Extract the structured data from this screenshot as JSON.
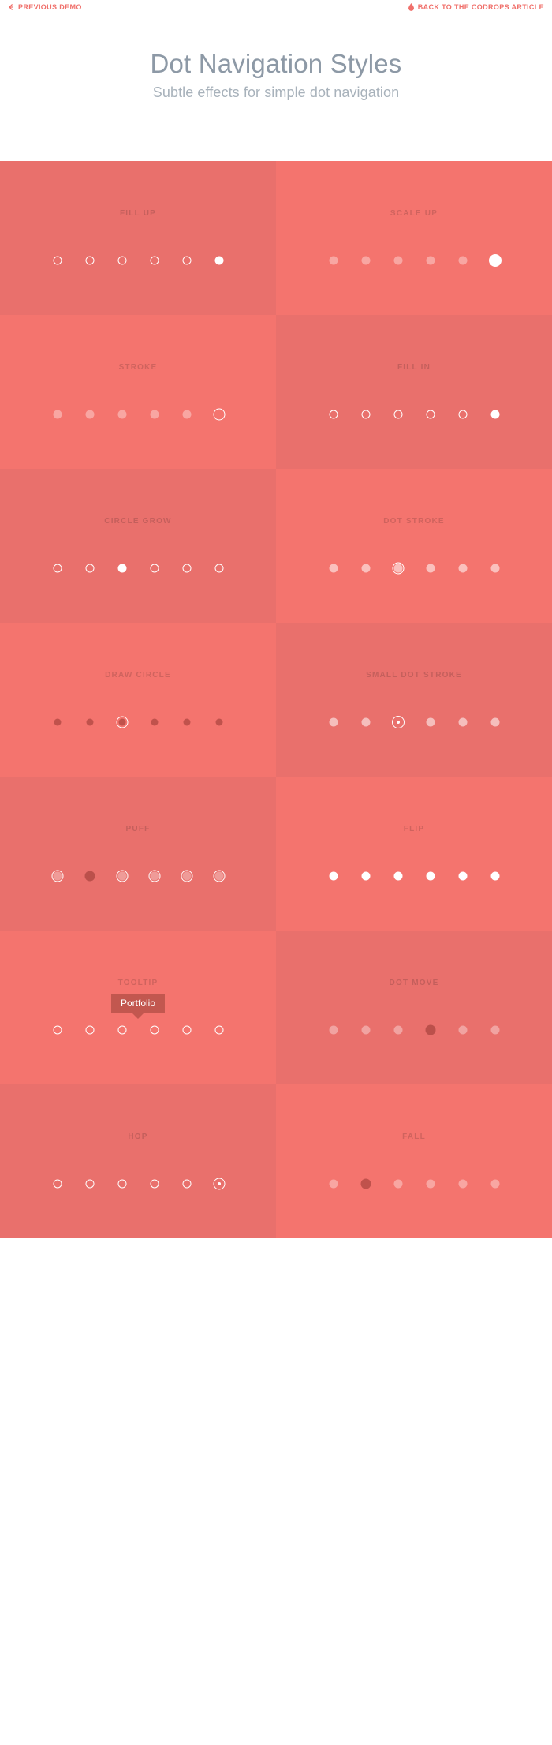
{
  "topbar": {
    "prev_label": "Previous demo",
    "prev_icon": "arrow-left-icon",
    "back_label": "Back to the Codrops article",
    "back_icon": "drop-icon",
    "link_color": "#f0706b"
  },
  "header": {
    "title": "Dot Navigation Styles",
    "subtitle": "Subtle effects for simple dot navigation",
    "title_color": "#8d99a6",
    "subtitle_color": "#a8b2bb"
  },
  "theme": {
    "tone_a": "#e9706c",
    "tone_b": "#f4746e",
    "label_color": "#c45f5c",
    "tooltip_bg": "#c2574f",
    "dot_color": "#ffffff"
  },
  "grid": {
    "columns": 2,
    "dots_per_cell": 6,
    "cells": [
      {
        "title": "Fill up",
        "tone": "tone-a",
        "active_index": 5,
        "style": "fill-up"
      },
      {
        "title": "Scale up",
        "tone": "tone-b",
        "active_index": 5,
        "style": "scale-up"
      },
      {
        "title": "Stroke",
        "tone": "tone-b",
        "active_index": 5,
        "style": "stroke"
      },
      {
        "title": "Fill in",
        "tone": "tone-a",
        "active_index": 5,
        "style": "fill-in"
      },
      {
        "title": "Circle grow",
        "tone": "tone-a",
        "active_index": 2,
        "style": "circle-grow"
      },
      {
        "title": "Dot stroke",
        "tone": "tone-b",
        "active_index": 2,
        "style": "dot-stroke"
      },
      {
        "title": "Draw circle",
        "tone": "tone-b",
        "active_index": 2,
        "style": "draw-circle"
      },
      {
        "title": "Small dot stroke",
        "tone": "tone-a",
        "active_index": 2,
        "style": "small-dot-stroke"
      },
      {
        "title": "Puff",
        "tone": "tone-a",
        "active_index": 1,
        "style": "puff"
      },
      {
        "title": "Flip",
        "tone": "tone-b",
        "active_index": 0,
        "style": "flip"
      },
      {
        "title": "Tooltip",
        "tone": "tone-b",
        "active_index": 2,
        "style": "tooltip",
        "tooltip_label": "Portfolio"
      },
      {
        "title": "Dot move",
        "tone": "tone-a",
        "active_index": 3,
        "style": "dot-move"
      },
      {
        "title": "Hop",
        "tone": "tone-a",
        "active_index": 5,
        "style": "hop"
      },
      {
        "title": "Fall",
        "tone": "tone-b",
        "active_index": 1,
        "style": "fall"
      }
    ]
  }
}
